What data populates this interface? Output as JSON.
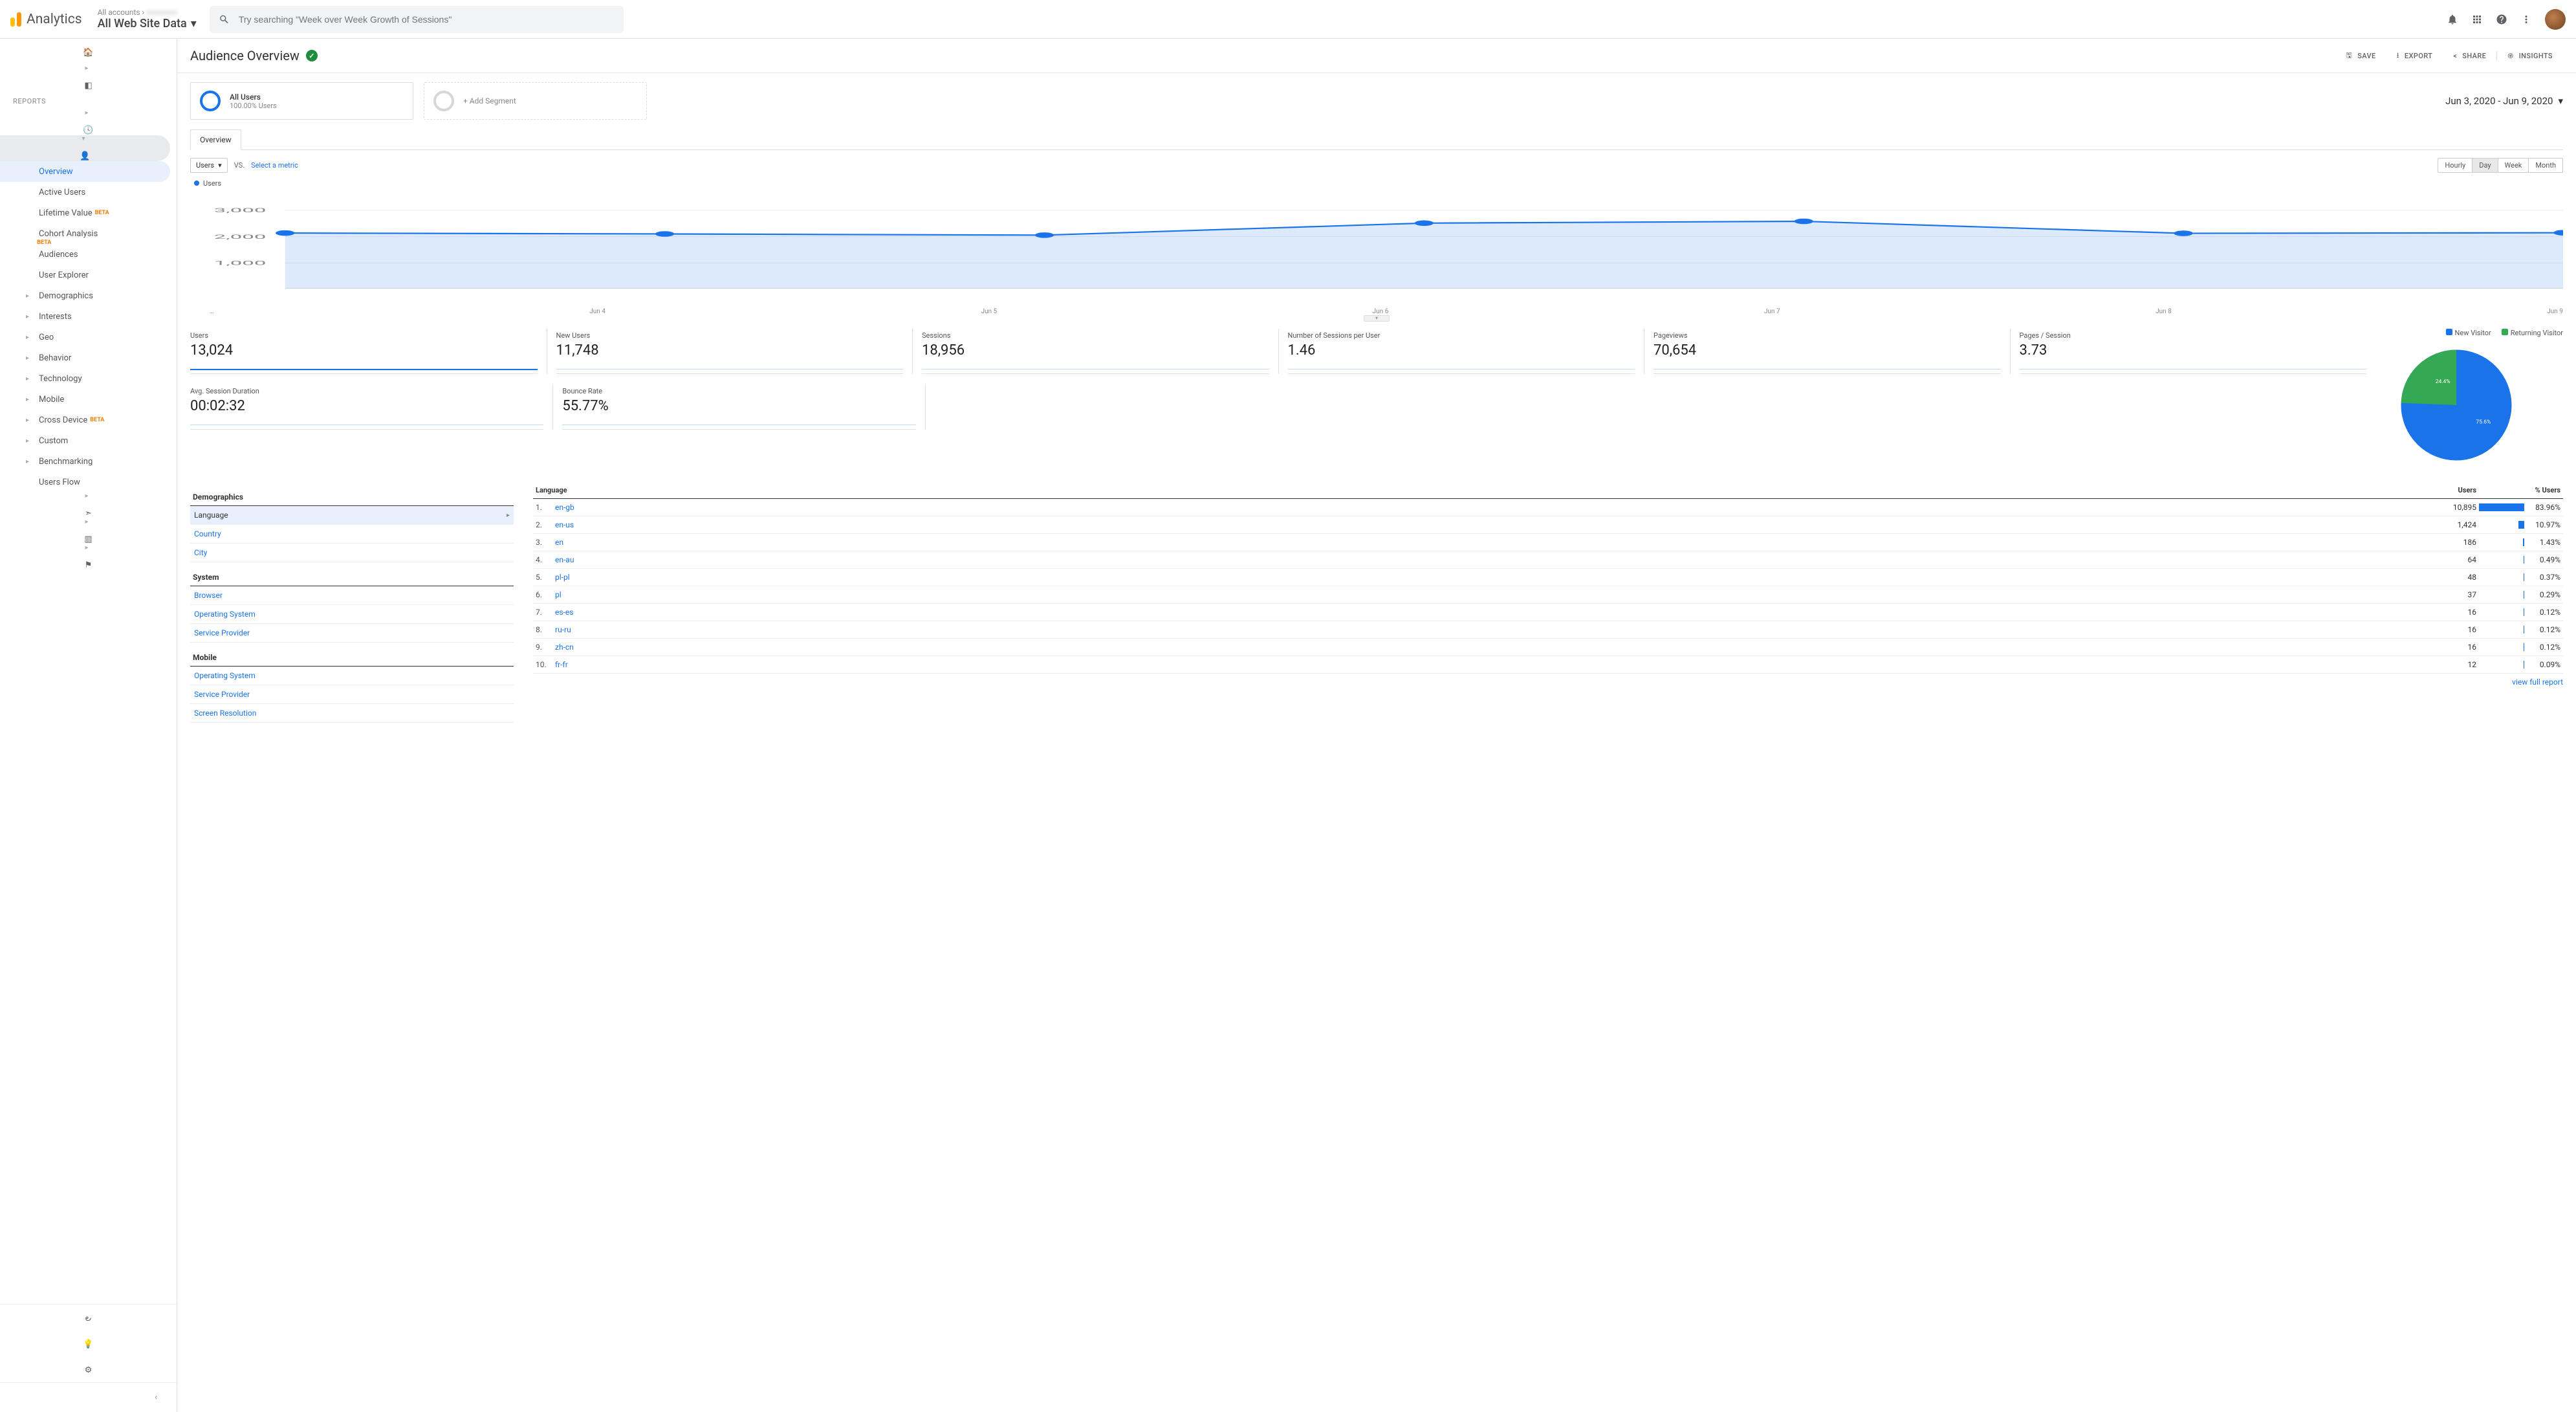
{
  "brand": {
    "name": "Analytics"
  },
  "breadcrumb": {
    "accounts": "All accounts",
    "view": "All Web Site Data"
  },
  "search": {
    "placeholder": "Try searching \"Week over Week Growth of Sessions\""
  },
  "nav": {
    "home": "Home",
    "customization": "Customization",
    "reports_label": "REPORTS",
    "realtime": "Realtime",
    "audience": "Audience",
    "audience_sub": {
      "overview": "Overview",
      "active_users": "Active Users",
      "lifetime_value": "Lifetime Value",
      "cohort": "Cohort Analysis",
      "audiences": "Audiences",
      "user_explorer": "User Explorer",
      "demographics": "Demographics",
      "interests": "Interests",
      "geo": "Geo",
      "behavior": "Behavior",
      "technology": "Technology",
      "mobile": "Mobile",
      "cross_device": "Cross Device",
      "custom": "Custom",
      "benchmarking": "Benchmarking",
      "users_flow": "Users Flow"
    },
    "acquisition": "Acquisition",
    "behavior": "Behavior",
    "conversions": "Conversions",
    "attribution": "Attribution",
    "discover": "Discover",
    "admin": "Admin",
    "beta": "BETA"
  },
  "page": {
    "title": "Audience Overview",
    "save": "SAVE",
    "export": "EXPORT",
    "share": "SHARE",
    "insights": "INSIGHTS"
  },
  "segment": {
    "all_users": "All Users",
    "all_users_sub": "100.00% Users",
    "add_segment": "+ Add Segment"
  },
  "date_range": "Jun 3, 2020 - Jun 9, 2020",
  "tab": {
    "overview": "Overview"
  },
  "chart_controls": {
    "metric": "Users",
    "vs": "VS.",
    "select_metric": "Select a metric",
    "hourly": "Hourly",
    "day": "Day",
    "week": "Week",
    "month": "Month"
  },
  "chart_data": {
    "type": "line",
    "title": "",
    "xlabel": "",
    "ylabel": "",
    "ylim": [
      0,
      3000
    ],
    "x_labels": [
      "…",
      "Jun 4",
      "Jun 5",
      "Jun 6",
      "Jun 7",
      "Jun 8",
      "Jun 9"
    ],
    "y_ticks": [
      "1,000",
      "2,000",
      "3,000"
    ],
    "series": [
      {
        "name": "Users",
        "color": "#1a73e8",
        "values": [
          1850,
          1820,
          1780,
          2180,
          2240,
          1840,
          1860
        ]
      }
    ]
  },
  "metrics": [
    {
      "name": "Users",
      "value": "13,024"
    },
    {
      "name": "New Users",
      "value": "11,748"
    },
    {
      "name": "Sessions",
      "value": "18,956"
    },
    {
      "name": "Number of Sessions per User",
      "value": "1.46"
    },
    {
      "name": "Pageviews",
      "value": "70,654"
    },
    {
      "name": "Pages / Session",
      "value": "3.73"
    },
    {
      "name": "Avg. Session Duration",
      "value": "00:02:32"
    },
    {
      "name": "Bounce Rate",
      "value": "55.77%"
    }
  ],
  "pie": {
    "legend_new": "New Visitor",
    "legend_ret": "Returning Visitor",
    "type": "pie",
    "slices": [
      {
        "label": "New Visitor",
        "pct": 75.6,
        "color": "#1a73e8"
      },
      {
        "label": "Returning Visitor",
        "pct": 24.4,
        "color": "#34a853"
      }
    ],
    "label_new": "75.6%",
    "label_ret": "24.4%"
  },
  "dimensions": {
    "demographics": "Demographics",
    "language": "Language",
    "country": "Country",
    "city": "City",
    "system": "System",
    "browser": "Browser",
    "os": "Operating System",
    "sp": "Service Provider",
    "mobile": "Mobile",
    "m_os": "Operating System",
    "m_sp": "Service Provider",
    "m_sr": "Screen Resolution"
  },
  "lang_table": {
    "head_lang": "Language",
    "head_users": "Users",
    "head_pct": "% Users",
    "rows": [
      {
        "n": "1.",
        "lang": "en-gb",
        "users": "10,895",
        "pct": "83.96%",
        "bar": 70
      },
      {
        "n": "2.",
        "lang": "en-us",
        "users": "1,424",
        "pct": "10.97%",
        "bar": 9
      },
      {
        "n": "3.",
        "lang": "en",
        "users": "186",
        "pct": "1.43%",
        "bar": 2
      },
      {
        "n": "4.",
        "lang": "en-au",
        "users": "64",
        "pct": "0.49%",
        "bar": 1
      },
      {
        "n": "5.",
        "lang": "pl-pl",
        "users": "48",
        "pct": "0.37%",
        "bar": 1
      },
      {
        "n": "6.",
        "lang": "pl",
        "users": "37",
        "pct": "0.29%",
        "bar": 1
      },
      {
        "n": "7.",
        "lang": "es-es",
        "users": "16",
        "pct": "0.12%",
        "bar": 1
      },
      {
        "n": "8.",
        "lang": "ru-ru",
        "users": "16",
        "pct": "0.12%",
        "bar": 1
      },
      {
        "n": "9.",
        "lang": "zh-cn",
        "users": "16",
        "pct": "0.12%",
        "bar": 1
      },
      {
        "n": "10.",
        "lang": "fr-fr",
        "users": "12",
        "pct": "0.09%",
        "bar": 1
      }
    ],
    "view_full": "view full report"
  }
}
